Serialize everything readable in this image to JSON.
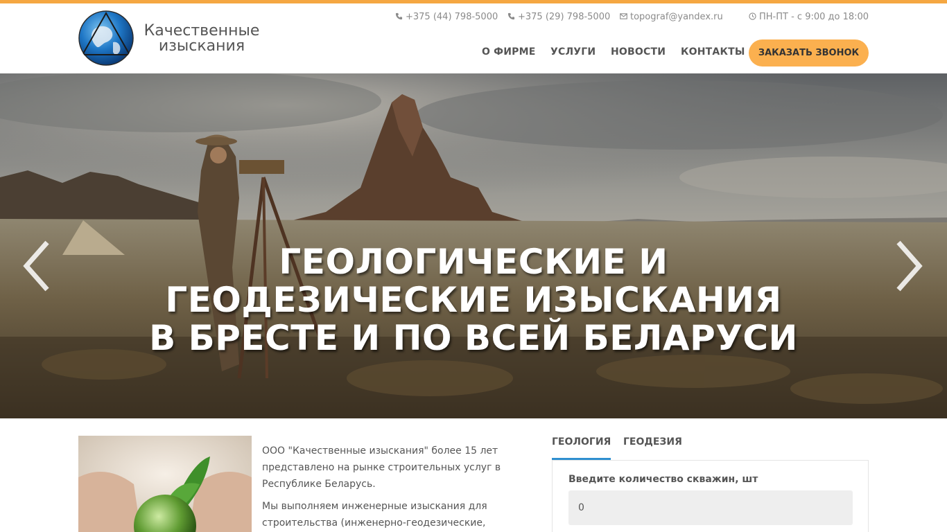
{
  "colors": {
    "accent": "#f5a742",
    "button": "#fbb04f",
    "tab_active": "#2f8fd0"
  },
  "header": {
    "logo_line1": "Качественные",
    "logo_line2": "изыскания",
    "contacts": [
      {
        "icon": "phone-icon",
        "text": "+375 (44) 798-5000"
      },
      {
        "icon": "phone-icon",
        "text": "+375 (29) 798-5000"
      },
      {
        "icon": "envelope-icon",
        "text": "topograf@yandex.ru"
      },
      {
        "icon": "clock-icon",
        "text": "ПН-ПТ - с 9:00 до 18:00"
      }
    ],
    "nav": [
      "О ФИРМЕ",
      "УСЛУГИ",
      "НОВОСТИ",
      "КОНТАКТЫ"
    ],
    "call_button": "ЗАКАЗАТЬ ЗВОНОК"
  },
  "hero": {
    "line1": "ГЕОЛОГИЧЕСКИЕ И",
    "line2": "ГЕОДЕЗИЧЕСКИЕ ИЗЫСКАНИЯ",
    "line3": "В БРЕСТЕ И ПО ВСЕЙ БЕЛАРУСИ"
  },
  "about": {
    "p1": "ООО \"Качественные изыскания\" более 15 лет представлено на рынке строительных услуг в Республике Беларусь.",
    "p2": "Мы выполняем инженерные изыскания для строительства (инженерно-геодезические, инженерно-"
  },
  "calculator": {
    "tabs": [
      "ГЕОЛОГИЯ",
      "ГЕОДЕЗИЯ"
    ],
    "field_label": "Введите количество скважин, шт",
    "field_value": "0"
  }
}
